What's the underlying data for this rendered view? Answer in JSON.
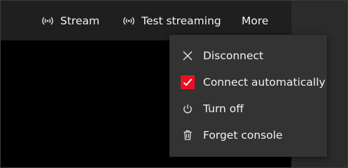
{
  "toolbar": {
    "items": [
      {
        "label": "Stream",
        "icon": "broadcast-icon"
      },
      {
        "label": "Test streaming",
        "icon": "broadcast-icon"
      },
      {
        "label": "More"
      }
    ]
  },
  "more_menu": {
    "items": [
      {
        "label": "Disconnect",
        "icon": "close-icon"
      },
      {
        "label": "Connect automatically",
        "icon": "checkbox-checked-icon",
        "checked": true
      },
      {
        "label": "Turn off",
        "icon": "power-icon"
      },
      {
        "label": "Forget console",
        "icon": "trash-icon"
      }
    ]
  },
  "colors": {
    "toolbar_bg": "#1f1f1f",
    "content_bg": "#000000",
    "menu_bg": "#333333",
    "text": "#f2f2f2",
    "checkbox_accent": "#e81123"
  }
}
